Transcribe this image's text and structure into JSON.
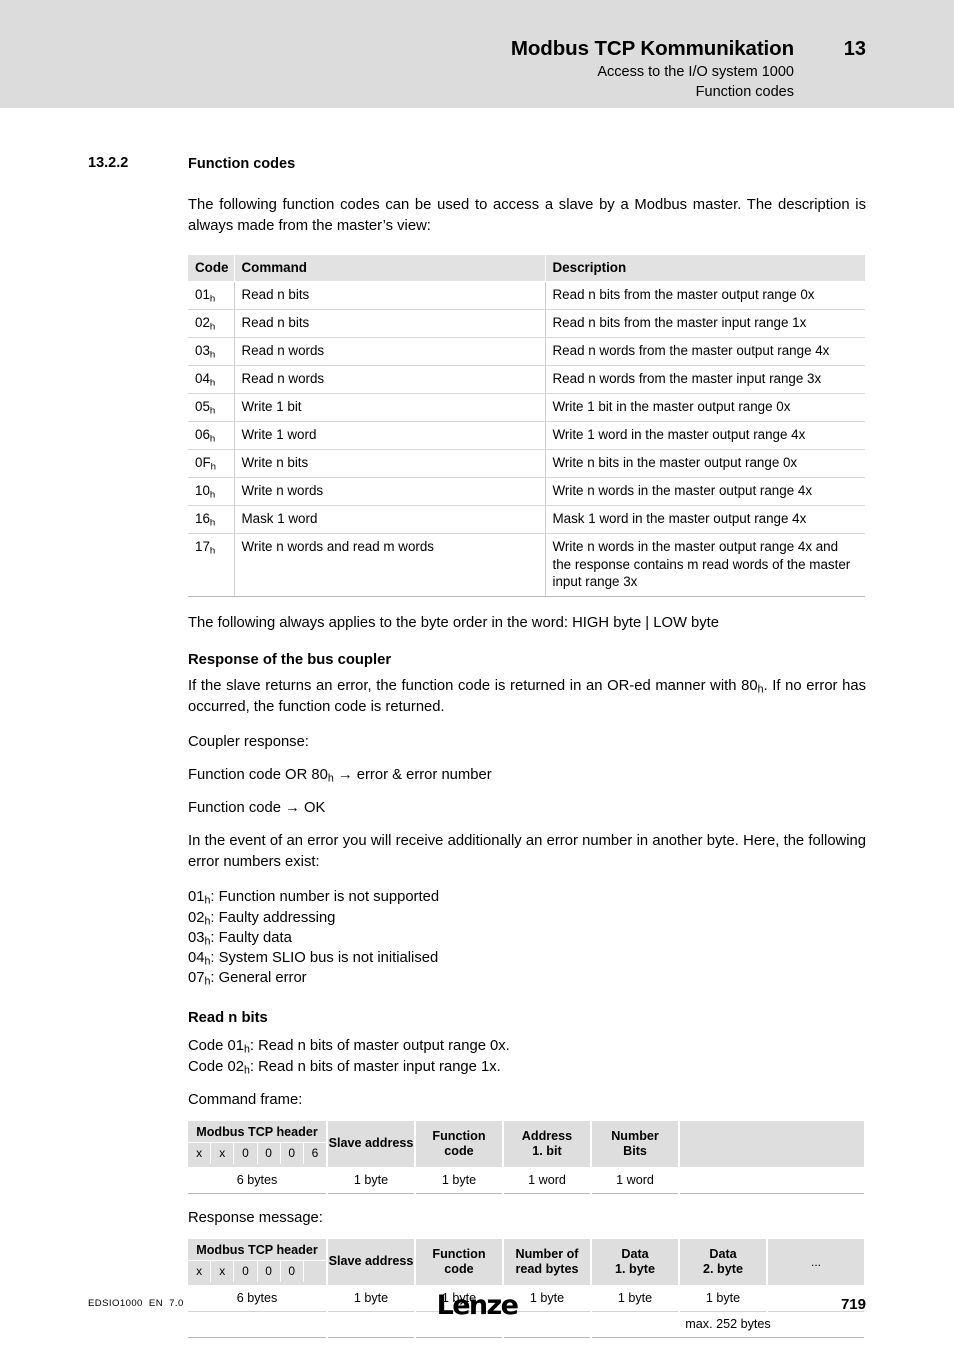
{
  "header": {
    "title": "Modbus TCP Kommunikation",
    "chapter": "13",
    "subtitle1": "Access to the I/O system 1000",
    "subtitle2": "Function codes"
  },
  "section": {
    "number": "13.2.2",
    "title": "Function codes",
    "intro": "The following function codes can be used to access a slave by a Modbus master. The description is always made from the master’s view:"
  },
  "function_code_table": {
    "headers": [
      "Code",
      "Command",
      "Description"
    ],
    "rows": [
      {
        "code": "01",
        "code_sub": "h",
        "command": "Read n bits",
        "description": "Read n bits from the master output range 0x"
      },
      {
        "code": "02",
        "code_sub": "h",
        "command": "Read n bits",
        "description": "Read n bits from the master input range 1x"
      },
      {
        "code": "03",
        "code_sub": "h",
        "command": "Read n words",
        "description": "Read n words from the master output range 4x"
      },
      {
        "code": "04",
        "code_sub": "h",
        "command": "Read n words",
        "description": "Read n words from the master input range 3x"
      },
      {
        "code": "05",
        "code_sub": "h",
        "command": "Write 1 bit",
        "description": "Write 1 bit in the master output range 0x"
      },
      {
        "code": "06",
        "code_sub": "h",
        "command": "Write 1 word",
        "description": "Write 1 word in the master output range 4x"
      },
      {
        "code": "0F",
        "code_sub": "h",
        "command": "Write n bits",
        "description": "Write n bits in the master output range 0x"
      },
      {
        "code": "10",
        "code_sub": "h",
        "command": "Write n words",
        "description": "Write n words in the master output range 4x"
      },
      {
        "code": "16",
        "code_sub": "h",
        "command": "Mask 1 word",
        "description": "Mask 1 word in the master output range 4x"
      },
      {
        "code": "17",
        "code_sub": "h",
        "command": "Write n words and read m words",
        "description": "Write n words in the master output range 4x and the response contains m read words of the master input range 3x"
      }
    ]
  },
  "body": {
    "byte_order_note": "The following always applies to the byte order in the word: HIGH byte | LOW byte",
    "response_heading": "Response of the bus coupler",
    "error_or_text_a": "If the slave returns an error, the function code is returned in an OR-ed manner with 80",
    "error_or_sub": "h",
    "error_or_text_b": ". If no error has occurred, the function code is returned.",
    "coupler_response_label": "Coupler response:",
    "coupler_line1_a": "Function code OR 80",
    "coupler_line1_sub": "h",
    "coupler_line1_b": " → error & error number",
    "coupler_line2": "Function code → OK",
    "error_intro": "In the event of an error you will receive additionally an error number in another byte. Here, the following error numbers exist:",
    "error_numbers": [
      {
        "code": "01",
        "sub": "h",
        "text": ": Function number is not supported"
      },
      {
        "code": "02",
        "sub": "h",
        "text": ": Faulty addressing"
      },
      {
        "code": "03",
        "sub": "h",
        "text": ": Faulty data"
      },
      {
        "code": "04",
        "sub": "h",
        "text": ": System SLIO bus is not initialised"
      },
      {
        "code": "07",
        "sub": "h",
        "text": ": General error"
      }
    ],
    "read_n_bits_heading": "Read n bits",
    "read_code_1_a": "Code 01",
    "read_code_1_sub": "h",
    "read_code_1_b": ": Read n bits of master output range 0x.",
    "read_code_2_a": "Code 02",
    "read_code_2_sub": "h",
    "read_code_2_b": ": Read n bits of master input range 1x.",
    "command_frame_label": "Command frame:",
    "response_message_label": "Response message:"
  },
  "command_frame": {
    "tcp_header_label": "Modbus TCP header",
    "tcp_header_bits": [
      "x",
      "x",
      "0",
      "0",
      "0",
      "6"
    ],
    "columns": [
      "Slave address",
      "Function\ncode",
      "Address\n1. bit",
      "Number\nBits",
      ""
    ],
    "col_slave": "Slave address",
    "col_function_l1": "Function",
    "col_function_l2": "code",
    "col_address_l1": "Address",
    "col_address_l2": "1. bit",
    "col_number_l1": "Number",
    "col_number_l2": "Bits",
    "col_last": "",
    "sizes": [
      "6 bytes",
      "1 byte",
      "1 byte",
      "1 word",
      "1 word",
      ""
    ]
  },
  "response_message": {
    "tcp_header_label": "Modbus TCP header",
    "tcp_header_bits": [
      "x",
      "x",
      "0",
      "0",
      "0",
      ""
    ],
    "col_slave": "Slave address",
    "col_function_l1": "Function",
    "col_function_l2": "code",
    "col_numread_l1": "Number of",
    "col_numread_l2": "read bytes",
    "col_data1_l1": "Data",
    "col_data1_l2": "1. byte",
    "col_data2_l1": "Data",
    "col_data2_l2": "2. byte",
    "col_ellipsis": "...",
    "sizes": [
      "6 bytes",
      "1 byte",
      "1 byte",
      "1 byte",
      "1 byte",
      "1 byte",
      ""
    ],
    "max_note": "max. 252 bytes"
  },
  "footer": {
    "doc_id": "EDSIO1000  EN  7.0",
    "logo": "Lenze",
    "page": "719"
  },
  "colors": {
    "header_band": "#dcdcdc",
    "table_header": "#e2e2e2",
    "frame_cell": "#dedede"
  }
}
